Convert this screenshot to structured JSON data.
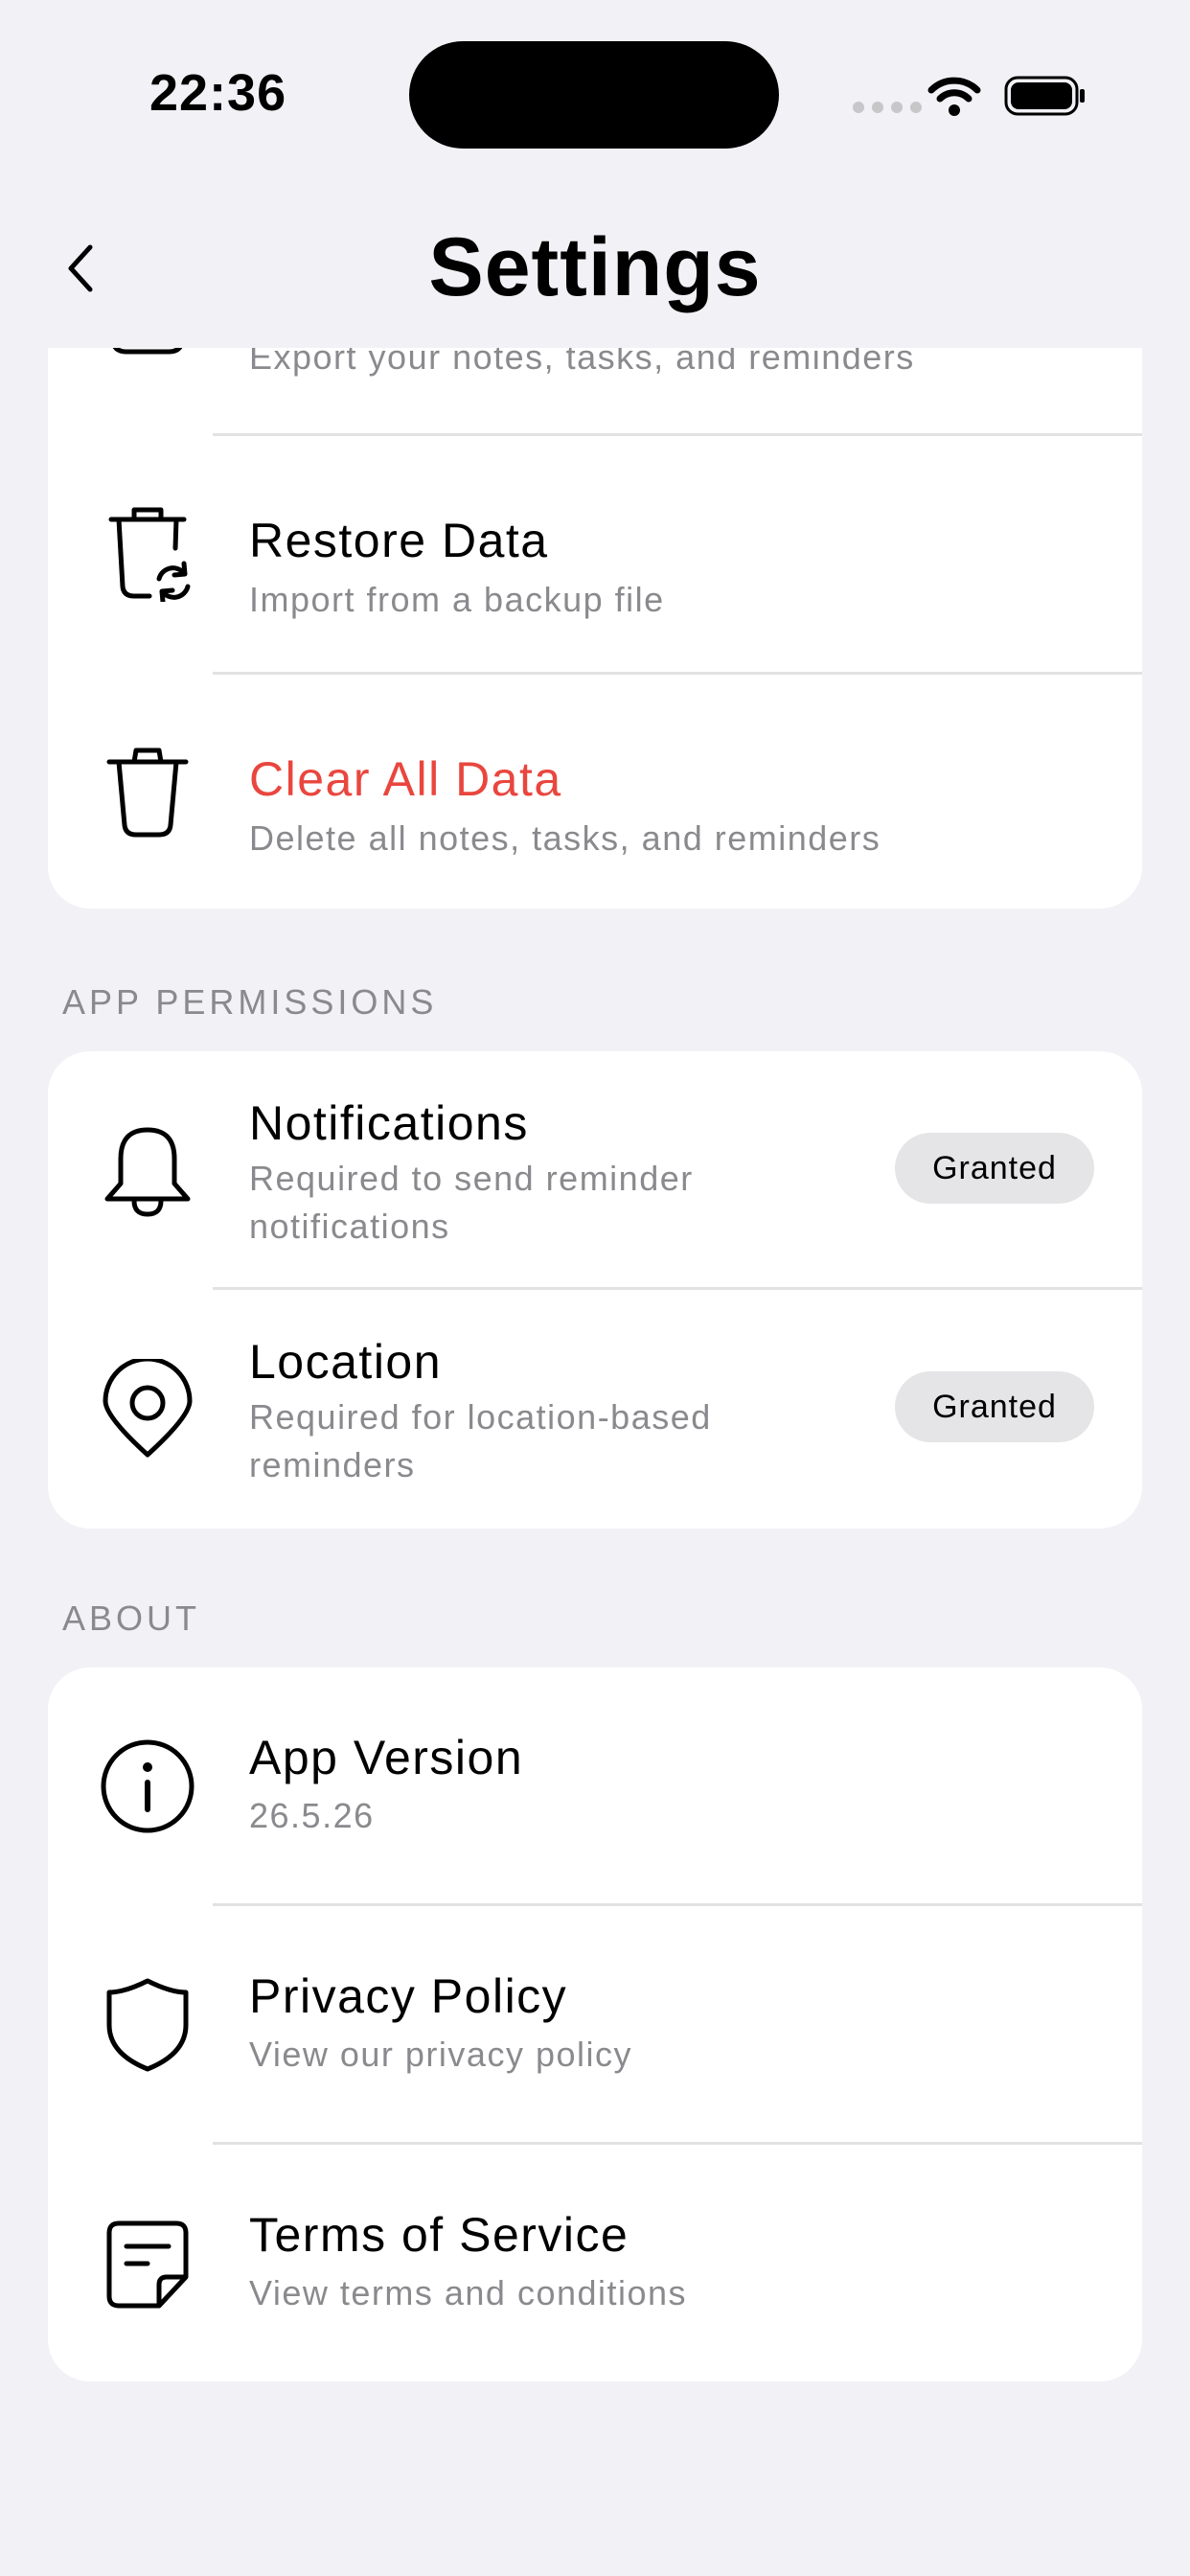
{
  "status_bar": {
    "time": "22:36"
  },
  "nav": {
    "title": "Settings"
  },
  "data_section": {
    "export_sub": "Export your notes, tasks, and reminders",
    "restore": {
      "label": "Restore Data",
      "sub": "Import from a backup file"
    },
    "clear": {
      "label": "Clear All Data",
      "sub": "Delete all notes, tasks, and reminders"
    }
  },
  "permissions": {
    "header": "APP PERMISSIONS",
    "notifications": {
      "label": "Notifications",
      "sub1": "Required to send reminder",
      "sub2": "notifications",
      "badge": "Granted"
    },
    "location": {
      "label": "Location",
      "sub1": "Required for location-based",
      "sub2": "reminders",
      "badge": "Granted"
    }
  },
  "about": {
    "header": "ABOUT",
    "version": {
      "label": "App Version",
      "sub": "26.5.26"
    },
    "privacy": {
      "label": "Privacy Policy",
      "sub": "View our privacy policy"
    },
    "terms": {
      "label": "Terms of Service",
      "sub": "View terms and conditions"
    }
  },
  "colors": {
    "background": "#f2f1f6",
    "destructive": "#e9463e",
    "secondary_text": "#8a8a8e",
    "badge_bg": "#e5e5e7"
  }
}
